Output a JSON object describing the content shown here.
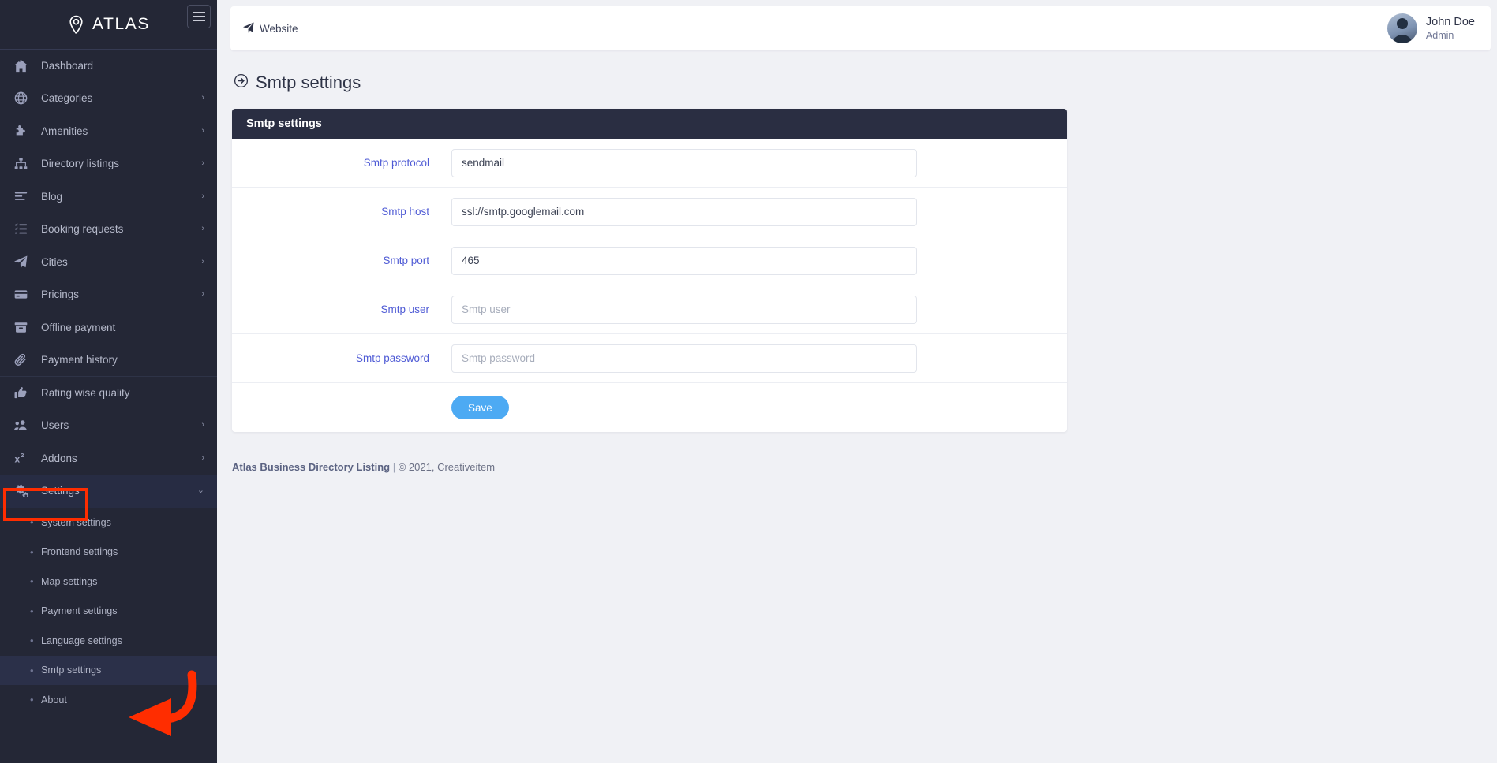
{
  "brand": {
    "name": "ATLAS",
    "logo_icon": "map-pin-icon",
    "menu_toggle_icon": "hamburger-icon"
  },
  "sidebar": {
    "items": [
      {
        "label": "Dashboard",
        "icon": "home-icon",
        "caret": "",
        "divider": false,
        "active": false
      },
      {
        "label": "Categories",
        "icon": "globe-icon",
        "caret": "›",
        "divider": false,
        "active": false
      },
      {
        "label": "Amenities",
        "icon": "puzzle-icon",
        "caret": "›",
        "divider": false,
        "active": false
      },
      {
        "label": "Directory listings",
        "icon": "sitemap-icon",
        "caret": "›",
        "divider": false,
        "active": false
      },
      {
        "label": "Blog",
        "icon": "align-left-icon",
        "caret": "›",
        "divider": false,
        "active": false
      },
      {
        "label": "Booking requests",
        "icon": "tasks-icon",
        "caret": "›",
        "divider": false,
        "active": false
      },
      {
        "label": "Cities",
        "icon": "paper-plane-icon",
        "caret": "›",
        "divider": false,
        "active": false
      },
      {
        "label": "Pricings",
        "icon": "credit-card-icon",
        "caret": "›",
        "divider": true,
        "active": false
      },
      {
        "label": "Offline payment",
        "icon": "archive-icon",
        "caret": "",
        "divider": true,
        "active": false
      },
      {
        "label": "Payment history",
        "icon": "paperclip-icon",
        "caret": "",
        "divider": true,
        "active": false
      },
      {
        "label": "Rating wise quality",
        "icon": "thumbs-up-icon",
        "caret": "",
        "divider": false,
        "active": false
      },
      {
        "label": "Users",
        "icon": "users-icon",
        "caret": "›",
        "divider": false,
        "active": false
      },
      {
        "label": "Addons",
        "icon": "superscript-icon",
        "caret": "›",
        "divider": false,
        "active": false
      },
      {
        "label": "Settings",
        "icon": "cogs-icon",
        "caret": "⌄",
        "divider": false,
        "active": true
      }
    ],
    "submenu": [
      {
        "label": "System settings",
        "active": false
      },
      {
        "label": "Frontend settings",
        "active": false
      },
      {
        "label": "Map settings",
        "active": false
      },
      {
        "label": "Payment settings",
        "active": false
      },
      {
        "label": "Language settings",
        "active": false
      },
      {
        "label": "Smtp settings",
        "active": true
      },
      {
        "label": "About",
        "active": false
      }
    ]
  },
  "topbar": {
    "website_label": "Website",
    "website_icon": "paper-plane-icon",
    "user": {
      "name": "John Doe",
      "role": "Admin",
      "avatar_icon": "user-avatar"
    }
  },
  "page": {
    "title": "Smtp settings",
    "title_icon": "arrow-circle-right-icon"
  },
  "card": {
    "heading": "Smtp settings",
    "fields": [
      {
        "label": "Smtp protocol",
        "value": "sendmail",
        "placeholder": "Smtp protocol",
        "type": "text"
      },
      {
        "label": "Smtp host",
        "value": "ssl://smtp.googlemail.com",
        "placeholder": "Smtp host",
        "type": "text"
      },
      {
        "label": "Smtp port",
        "value": "465",
        "placeholder": "Smtp port",
        "type": "text"
      },
      {
        "label": "Smtp user",
        "value": "",
        "placeholder": "Smtp user",
        "type": "text"
      },
      {
        "label": "Smtp password",
        "value": "",
        "placeholder": "Smtp password",
        "type": "text"
      }
    ],
    "save_label": "Save"
  },
  "footer": {
    "app_name": "Atlas Business Directory Listing",
    "separator": " | ",
    "copyright": "© 2021, Creativeitem"
  },
  "colors": {
    "sidebar_bg": "#242736",
    "sidebar_active": "#272c43",
    "card_header_bg": "#2a2e42",
    "label_blue": "#4f5bd5",
    "save_blue": "#4daaf3",
    "annotation_red": "#ff2d00",
    "page_bg": "#f0f1f5"
  }
}
